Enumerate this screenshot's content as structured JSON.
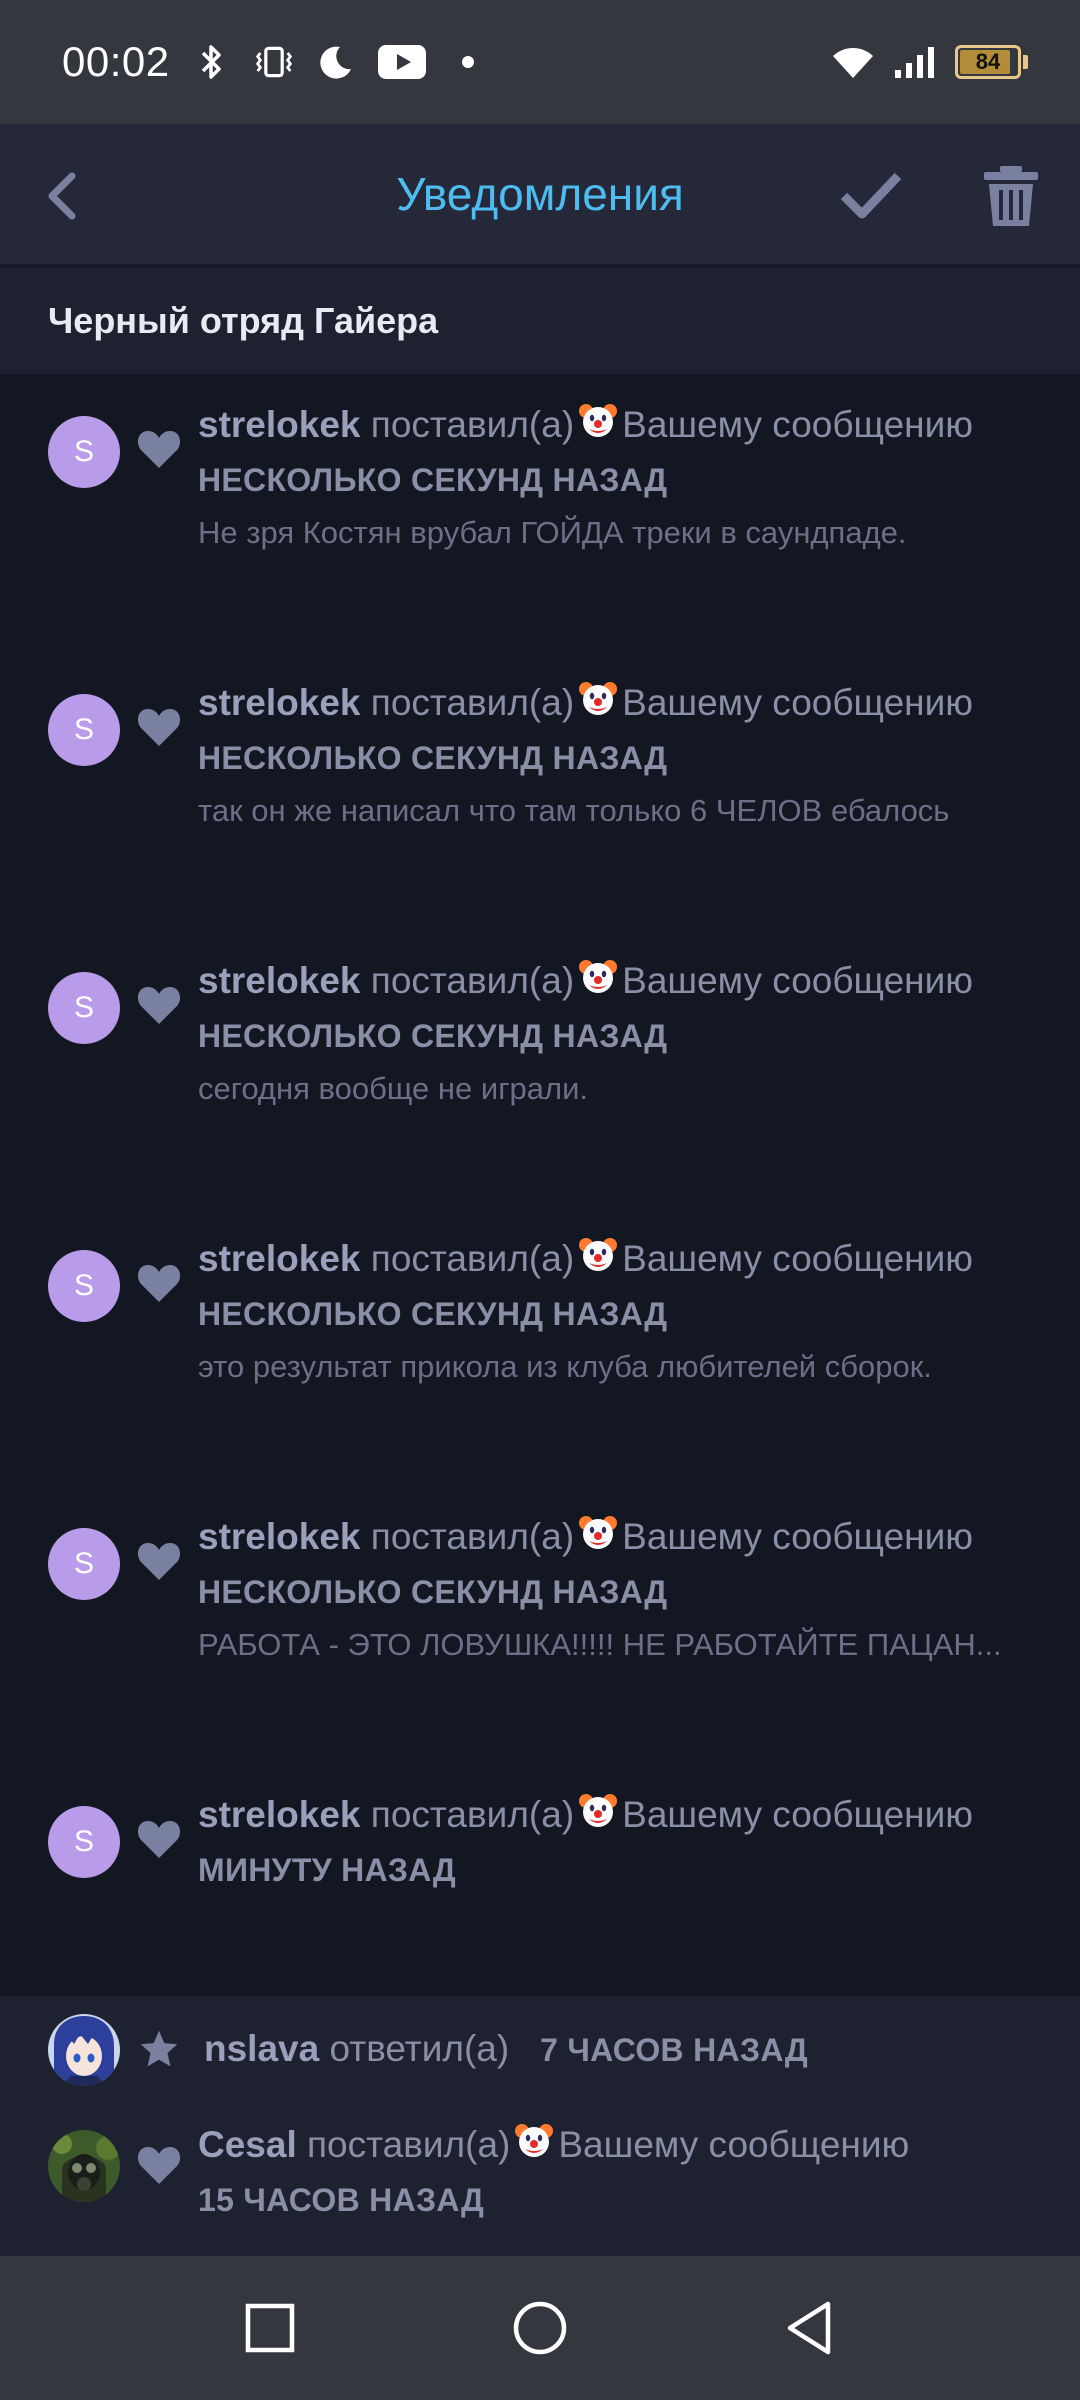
{
  "status_bar": {
    "time": "00:02",
    "battery": "84",
    "icons": [
      "bluetooth-icon",
      "vibrate-icon",
      "moon-icon",
      "youtube-icon",
      "dot-icon",
      "wifi-icon",
      "signal-icon",
      "battery-icon"
    ]
  },
  "app_bar": {
    "title": "Уведомления",
    "title_color": "#4fbcf0"
  },
  "group": {
    "title": "Черный отряд Гайера"
  },
  "notifications": [
    {
      "avatar_letter": "S",
      "type_icon": "heart-icon",
      "user": "strelokek",
      "action": "поставил(а)",
      "reaction": "clown-emoji",
      "target": "Вашему сообщению",
      "time": "НЕСКОЛЬКО СЕКУНД НАЗАД",
      "preview": "Не зря Костян врубал ГОЙДА треки в саундпаде."
    },
    {
      "avatar_letter": "S",
      "type_icon": "heart-icon",
      "user": "strelokek",
      "action": "поставил(а)",
      "reaction": "clown-emoji",
      "target": "Вашему сообщению",
      "time": "НЕСКОЛЬКО СЕКУНД НАЗАД",
      "preview": "так он же написал что там только 6 ЧЕЛОВ ебалось"
    },
    {
      "avatar_letter": "S",
      "type_icon": "heart-icon",
      "user": "strelokek",
      "action": "поставил(а)",
      "reaction": "clown-emoji",
      "target": "Вашему сообщению",
      "time": "НЕСКОЛЬКО СЕКУНД НАЗАД",
      "preview": "сегодня вообще не играли."
    },
    {
      "avatar_letter": "S",
      "type_icon": "heart-icon",
      "user": "strelokek",
      "action": "поставил(а)",
      "reaction": "clown-emoji",
      "target": "Вашему сообщению",
      "time": "НЕСКОЛЬКО СЕКУНД НАЗАД",
      "preview": "это результат прикола из клуба любителей сборок."
    },
    {
      "avatar_letter": "S",
      "type_icon": "heart-icon",
      "user": "strelokek",
      "action": "поставил(а)",
      "reaction": "clown-emoji",
      "target": "Вашему сообщению",
      "time": "НЕСКОЛЬКО СЕКУНД НАЗАД",
      "preview": "РАБОТА - ЭТО ЛОВУШКА!!!!! НЕ РАБОТАЙТЕ ПАЦАН..."
    },
    {
      "avatar_letter": "S",
      "type_icon": "heart-icon",
      "user": "strelokek",
      "action": "поставил(а)",
      "reaction": "clown-emoji",
      "target": "Вашему сообщению",
      "time": "МИНУТУ НАЗАД",
      "preview": ""
    }
  ],
  "older": [
    {
      "avatar": "anime-girl-avatar",
      "type_icon": "star-icon",
      "user": "nslava",
      "action": "ответил(а)",
      "time": "7 ЧАСОВ НАЗАД"
    },
    {
      "avatar": "stalker-gasmask-avatar",
      "type_icon": "heart-icon",
      "user": "Cesal",
      "action": "поставил(а)",
      "reaction": "clown-emoji",
      "target": "Вашему сообщению",
      "time": "15 ЧАСОВ НАЗАД"
    }
  ],
  "nav_bar": {
    "buttons": [
      "recents-square-icon",
      "home-circle-icon",
      "back-triangle-icon"
    ]
  },
  "colors": {
    "accent": "#4fbcf0",
    "avatar": "#b89be9",
    "background": "#131722",
    "header": "#242838"
  }
}
